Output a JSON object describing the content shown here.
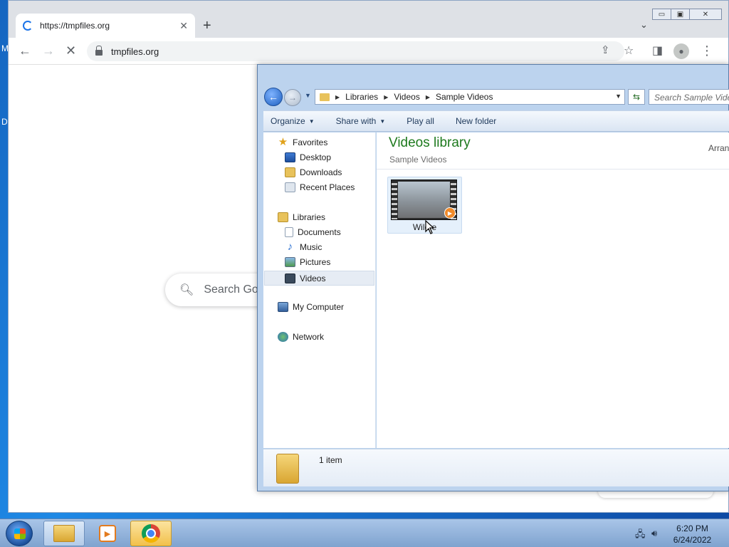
{
  "desktop": {
    "letters": [
      "M",
      "D"
    ]
  },
  "browser": {
    "tab": {
      "title": "https://tmpfiles.org"
    },
    "new_tab_glyph": "+",
    "window_controls": {
      "minimize": "▭",
      "maximize": "▣",
      "close": "✕"
    },
    "address": "tmpfiles.org",
    "search_placeholder": "Search Goo",
    "icons": [
      "back-arrow-icon",
      "forward-arrow-icon",
      "stop-loading-icon",
      "lock-icon",
      "share-icon",
      "star-icon",
      "side-panel-icon",
      "profile-icon",
      "kebab-menu-icon"
    ]
  },
  "explorer": {
    "breadcrumb": [
      "Libraries",
      "Videos",
      "Sample Videos"
    ],
    "search_placeholder": "Search Sample Vide",
    "commands": {
      "organize": "Organize",
      "share_with": "Share with",
      "play_all": "Play all",
      "new_folder": "New folder"
    },
    "nav": {
      "favorites": "Favorites",
      "desktop": "Desktop",
      "downloads": "Downloads",
      "recent_places": "Recent Places",
      "libraries": "Libraries",
      "documents": "Documents",
      "music": "Music",
      "pictures": "Pictures",
      "videos": "Videos",
      "my_computer": "My Computer",
      "network": "Network"
    },
    "library_title": "Videos library",
    "library_subtitle": "Sample Videos",
    "arrange_label": "Arran",
    "items": [
      {
        "label": "Wild e"
      }
    ],
    "status": "1 item"
  },
  "taskbar": {
    "clock_time": "6:20 PM",
    "clock_date": "6/24/2022"
  }
}
